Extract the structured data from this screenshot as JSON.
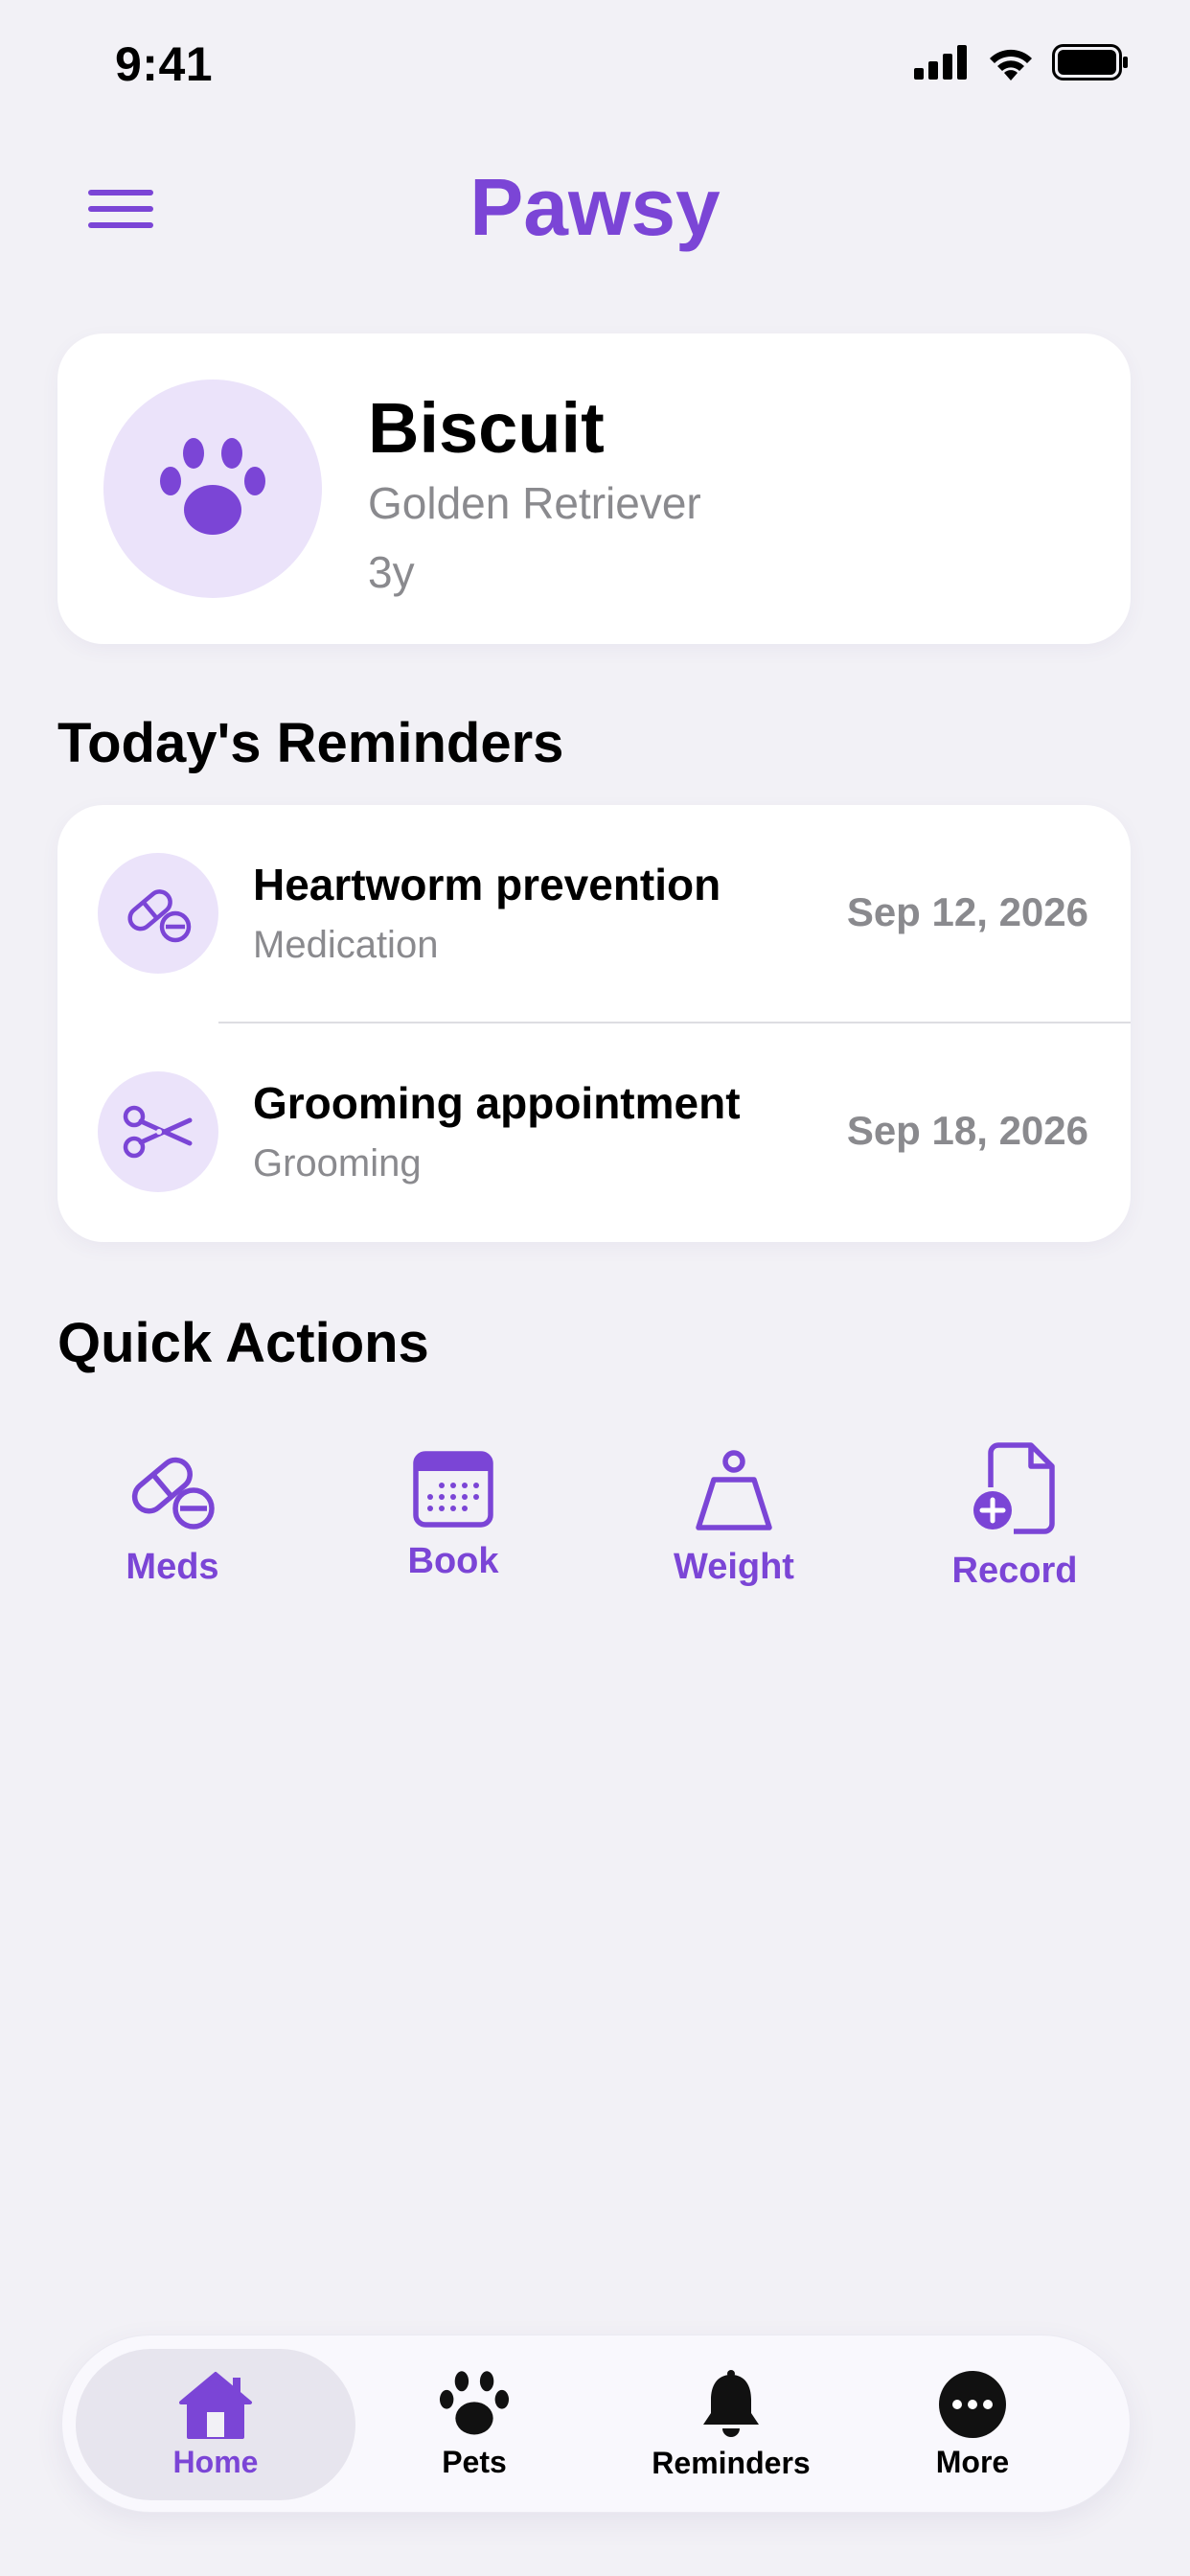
{
  "status_bar": {
    "time": "9:41"
  },
  "header": {
    "title": "Pawsy",
    "menu_icon": "hamburger-menu-icon"
  },
  "pet": {
    "name": "Biscuit",
    "breed": "Golden Retriever",
    "age": "3y",
    "avatar_icon": "paw-icon"
  },
  "reminders": {
    "section_title": "Today's Reminders",
    "items": [
      {
        "title": "Heartworm prevention",
        "category": "Medication",
        "date": "Sep 12, 2026",
        "icon": "pill-icon"
      },
      {
        "title": "Grooming appointment",
        "category": "Grooming",
        "date": "Sep 18, 2026",
        "icon": "scissors-icon"
      }
    ]
  },
  "quick_actions": {
    "section_title": "Quick Actions",
    "items": [
      {
        "label": "Meds",
        "icon": "pill-icon"
      },
      {
        "label": "Book",
        "icon": "calendar-icon"
      },
      {
        "label": "Weight",
        "icon": "weight-scale-icon"
      },
      {
        "label": "Record",
        "icon": "document-add-icon"
      }
    ]
  },
  "tab_bar": {
    "tabs": [
      {
        "label": "Home",
        "icon": "house-icon",
        "active": true
      },
      {
        "label": "Pets",
        "icon": "paw-icon",
        "active": false
      },
      {
        "label": "Reminders",
        "icon": "bell-icon",
        "active": false
      },
      {
        "label": "More",
        "icon": "ellipsis-circle-icon",
        "active": false
      }
    ]
  },
  "colors": {
    "accent": "#7b45d6",
    "accent_light": "#ebe3fa",
    "background": "#f2f1f6",
    "secondary_text": "#8a8a8e"
  }
}
